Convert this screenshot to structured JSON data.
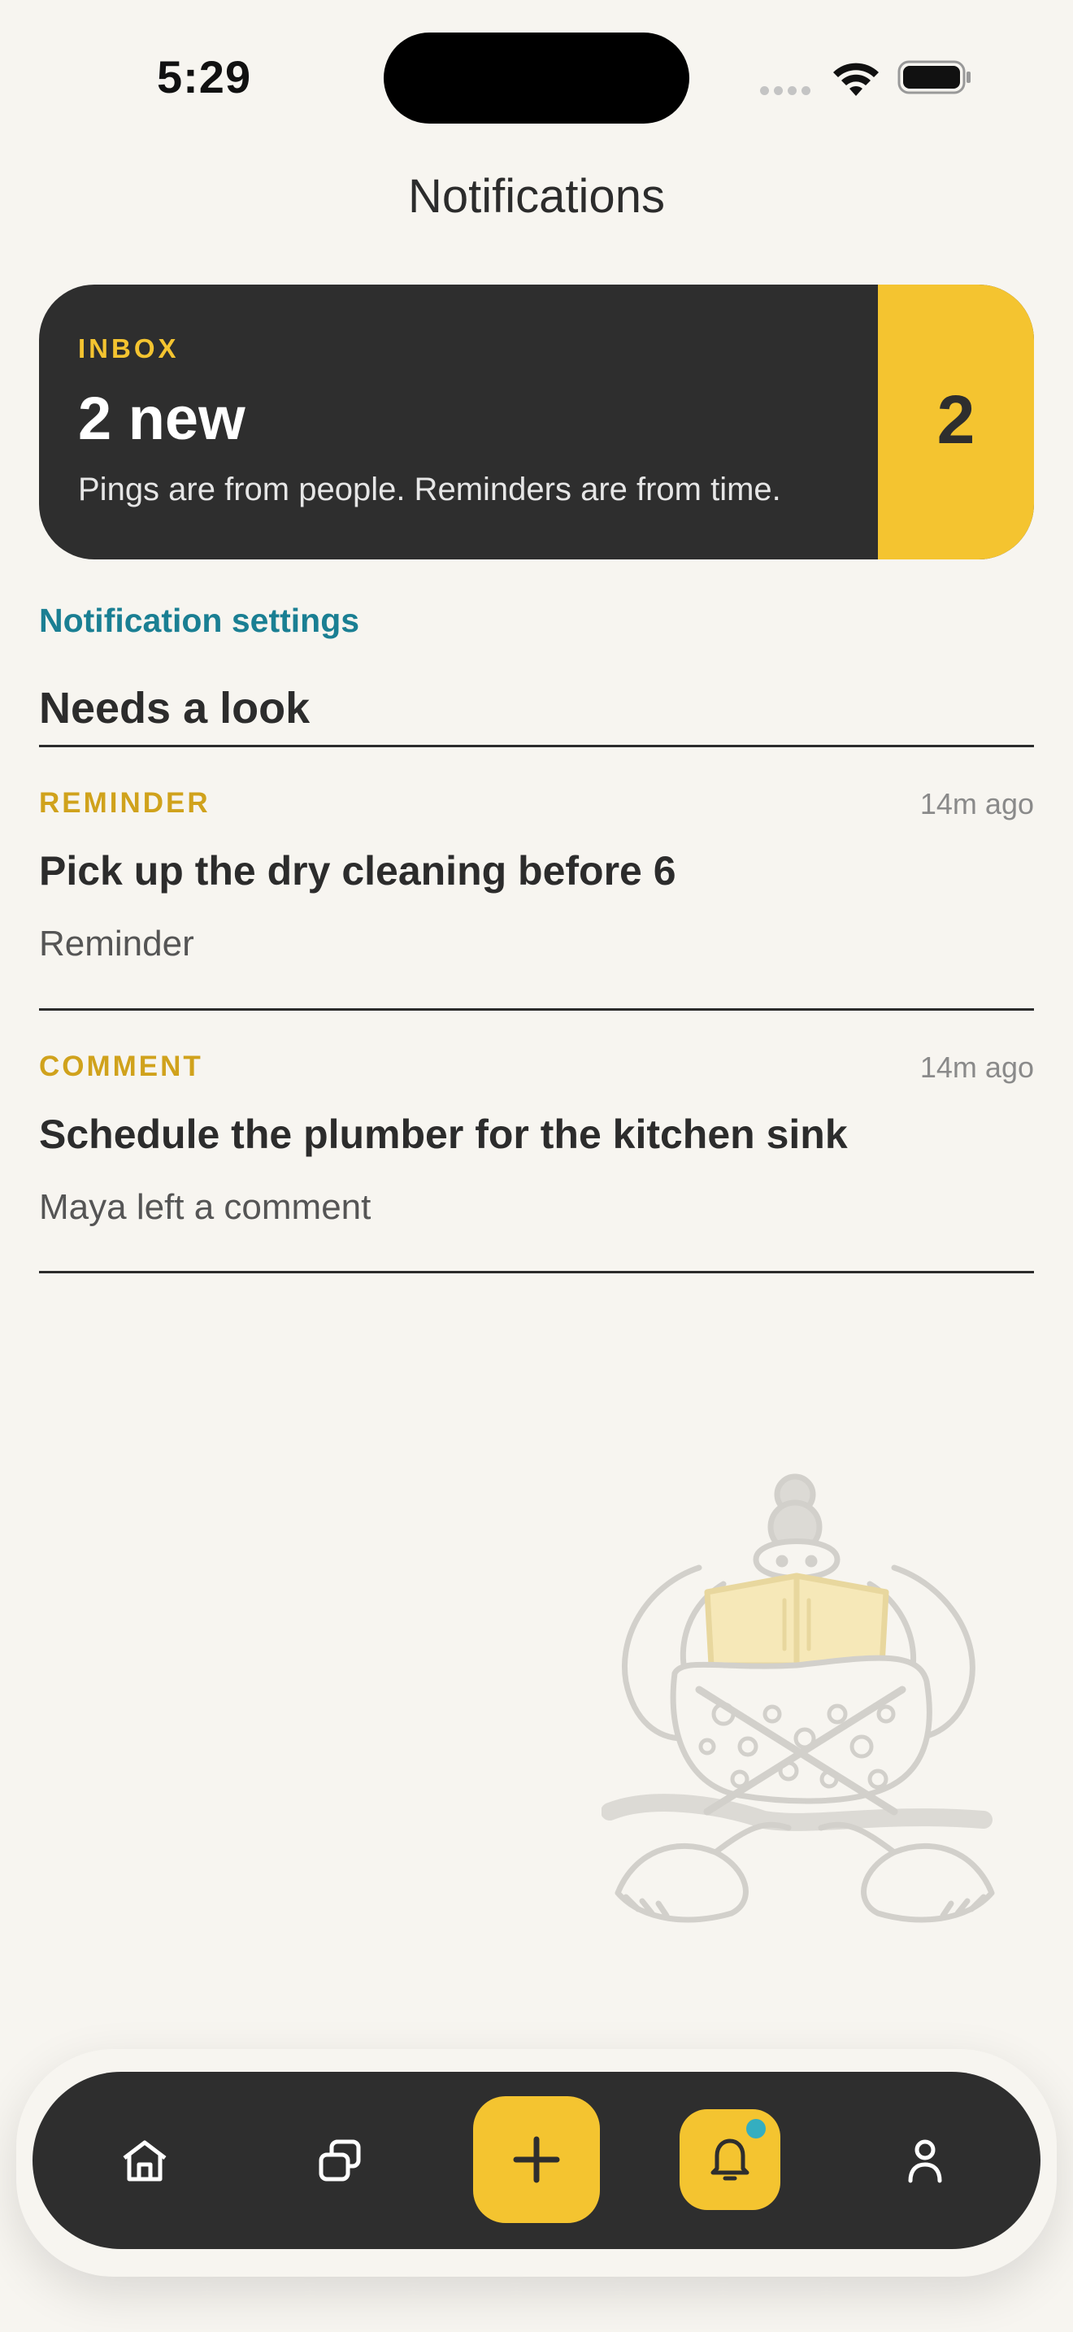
{
  "status_bar": {
    "time": "5:29"
  },
  "header": {
    "title": "Notifications"
  },
  "inbox": {
    "eyebrow": "INBOX",
    "title": "2 new",
    "subtitle": "Pings are from people. Reminders are from time.",
    "count": "2"
  },
  "settings_link": "Notification settings",
  "section": {
    "title": "Needs a look"
  },
  "notifications": [
    {
      "kind": "REMINDER",
      "time": "14m ago",
      "title": "Pick up the dry cleaning before 6",
      "subtitle": "Reminder"
    },
    {
      "kind": "COMMENT",
      "time": "14m ago",
      "title": "Schedule the plumber for the kitchen sink",
      "subtitle": "Maya left a comment"
    }
  ],
  "tabbar": {
    "items": [
      {
        "icon": "home-icon"
      },
      {
        "icon": "stack-icon"
      },
      {
        "icon": "plus-icon"
      },
      {
        "icon": "bell-icon"
      },
      {
        "icon": "profile-icon"
      }
    ],
    "active": "bell-icon"
  },
  "colors": {
    "background": "#f7f5f0",
    "card": "#2e2e2e",
    "accent": "#f4c430",
    "link": "#1a7f93",
    "kind_label": "#d0a21c",
    "badge_dot": "#34aec0"
  }
}
